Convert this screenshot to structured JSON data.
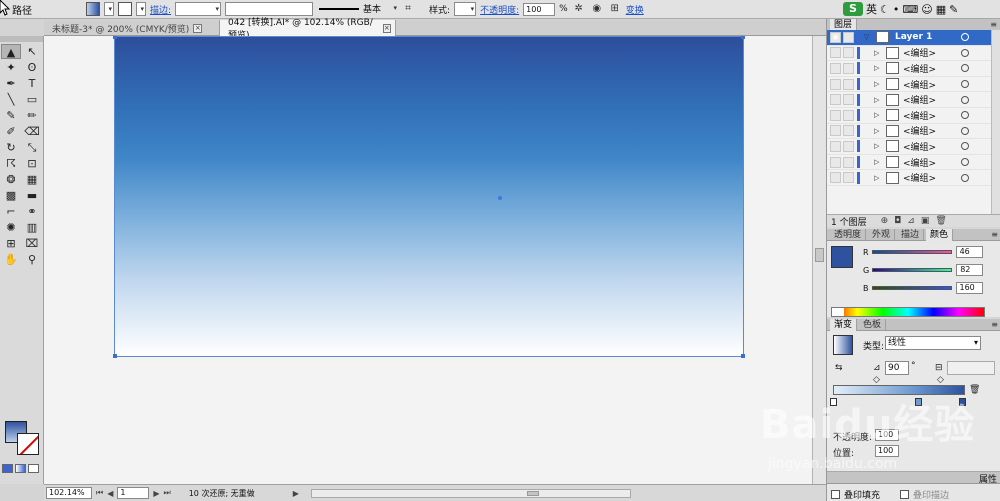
{
  "control_bar": {
    "object_type": "路径",
    "stroke_link": "描边:",
    "stroke_style": "基本",
    "style_label": "样式:",
    "opacity_link": "不透明度:",
    "opacity_value": "100",
    "opacity_unit": "%",
    "transform_link": "变换"
  },
  "ime": {
    "logo": "S",
    "lang": "英",
    "icons": [
      "moon-icon",
      "dot-icon",
      "keyboard-icon",
      "wrench-icon"
    ]
  },
  "tabs": [
    {
      "label": "未标题-3* @ 200% (CMYK/预览)",
      "active": false
    },
    {
      "label": "042 [转换].AI* @ 102.14% (RGB/预览)",
      "active": true
    }
  ],
  "tools": [
    {
      "icon": "selection-tool-icon",
      "glyph": "▲"
    },
    {
      "icon": "direct-selection-tool-icon",
      "glyph": "↖"
    },
    {
      "icon": "magic-wand-tool-icon",
      "glyph": "✦"
    },
    {
      "icon": "lasso-tool-icon",
      "glyph": "ʘ"
    },
    {
      "icon": "pen-tool-icon",
      "glyph": "✒"
    },
    {
      "icon": "type-tool-icon",
      "glyph": "T"
    },
    {
      "icon": "line-tool-icon",
      "glyph": "╲"
    },
    {
      "icon": "rectangle-tool-icon",
      "glyph": "▭"
    },
    {
      "icon": "paintbrush-tool-icon",
      "glyph": "✎"
    },
    {
      "icon": "pencil-tool-icon",
      "glyph": "✏"
    },
    {
      "icon": "blob-brush-tool-icon",
      "glyph": "✐"
    },
    {
      "icon": "eraser-tool-icon",
      "glyph": "⌫"
    },
    {
      "icon": "rotate-tool-icon",
      "glyph": "↻"
    },
    {
      "icon": "scale-tool-icon",
      "glyph": "⤡"
    },
    {
      "icon": "warp-tool-icon",
      "glyph": "☈"
    },
    {
      "icon": "free-transform-tool-icon",
      "glyph": "⊡"
    },
    {
      "icon": "shape-builder-tool-icon",
      "glyph": "❂"
    },
    {
      "icon": "perspective-grid-tool-icon",
      "glyph": "▦"
    },
    {
      "icon": "mesh-tool-icon",
      "glyph": "▩"
    },
    {
      "icon": "gradient-tool-icon",
      "glyph": "▬"
    },
    {
      "icon": "eyedropper-tool-icon",
      "glyph": "⌐"
    },
    {
      "icon": "blend-tool-icon",
      "glyph": "⚭"
    },
    {
      "icon": "symbol-sprayer-tool-icon",
      "glyph": "✺"
    },
    {
      "icon": "column-graph-tool-icon",
      "glyph": "▥"
    },
    {
      "icon": "artboard-tool-icon",
      "glyph": "⊞"
    },
    {
      "icon": "slice-tool-icon",
      "glyph": "⌧"
    },
    {
      "icon": "hand-tool-icon",
      "glyph": "✋"
    },
    {
      "icon": "zoom-tool-icon",
      "glyph": "⚲"
    }
  ],
  "status": {
    "zoom": "102.14%",
    "artboard_num": "1",
    "undo_info": "10 次还原; 无重做"
  },
  "layers_panel": {
    "tab": "图层",
    "top_layer": "Layer 1",
    "children": [
      "<编组>",
      "<编组>",
      "<编组>",
      "<编组>",
      "<编组>",
      "<编组>",
      "<编组>",
      "<编组>",
      "<编组>"
    ],
    "footer": "1 个图层"
  },
  "color_panel": {
    "tabs": [
      "透明度",
      "外观",
      "描边",
      "颜色"
    ],
    "channels": [
      {
        "label": "R",
        "value": "46"
      },
      {
        "label": "G",
        "value": "82"
      },
      {
        "label": "B",
        "value": "160"
      }
    ],
    "fill_color": "#2e52a0"
  },
  "gradient_panel": {
    "tabs": [
      "渐变",
      "色板"
    ],
    "type_label": "类型:",
    "type_value": "线性",
    "angle": "90",
    "deg": "°",
    "opacity_label": "不透明度:",
    "opacity_value": "100",
    "location_label": "位置:",
    "location_value": "100"
  },
  "bottom_panel": {
    "tab": "属性",
    "overprint_fill": "叠印填充",
    "overprint_stroke": "叠印描边"
  },
  "watermark": {
    "text": "Baidu经验",
    "sub": "jingyan.baidu.com"
  }
}
